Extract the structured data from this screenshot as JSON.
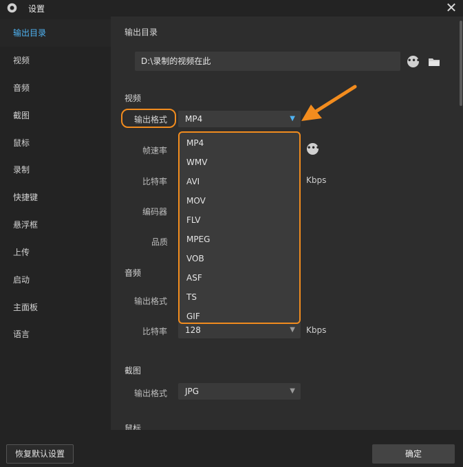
{
  "window": {
    "title": "设置",
    "close_glyph": "✕"
  },
  "sidebar": {
    "items": [
      {
        "label": "输出目录"
      },
      {
        "label": "视频"
      },
      {
        "label": "音频"
      },
      {
        "label": "截图"
      },
      {
        "label": "鼠标"
      },
      {
        "label": "录制"
      },
      {
        "label": "快捷键"
      },
      {
        "label": "悬浮框"
      },
      {
        "label": "上传"
      },
      {
        "label": "启动"
      },
      {
        "label": "主面板"
      },
      {
        "label": "语言"
      }
    ],
    "active": "输出目录"
  },
  "output_dir": {
    "heading": "输出目录",
    "path": "D:\\录制的视频在此",
    "more_glyph": "•••"
  },
  "video": {
    "heading": "视频",
    "format_label": "输出格式",
    "format_value": "MP4",
    "framerate_label": "帧速率",
    "bitrate_label": "比特率",
    "bitrate_unit": "Kbps",
    "encoder_label": "编码器",
    "quality_label": "品质",
    "more_glyph": "•••"
  },
  "format_dropdown": {
    "options": [
      "MP4",
      "WMV",
      "AVI",
      "MOV",
      "FLV",
      "MPEG",
      "VOB",
      "ASF",
      "TS",
      "GIF"
    ]
  },
  "audio": {
    "heading": "音频",
    "format_label": "输出格式",
    "bitrate_label": "比特率",
    "bitrate_value": "128",
    "bitrate_unit": "Kbps"
  },
  "screenshot": {
    "heading": "截图",
    "format_label": "输出格式",
    "format_value": "JPG"
  },
  "mouse": {
    "heading": "鼠标"
  },
  "footer": {
    "reset_label": "恢复默认设置",
    "ok_label": "确定"
  },
  "colors": {
    "accent_blue": "#4fb3f2",
    "highlight_orange": "#f28c1e"
  }
}
